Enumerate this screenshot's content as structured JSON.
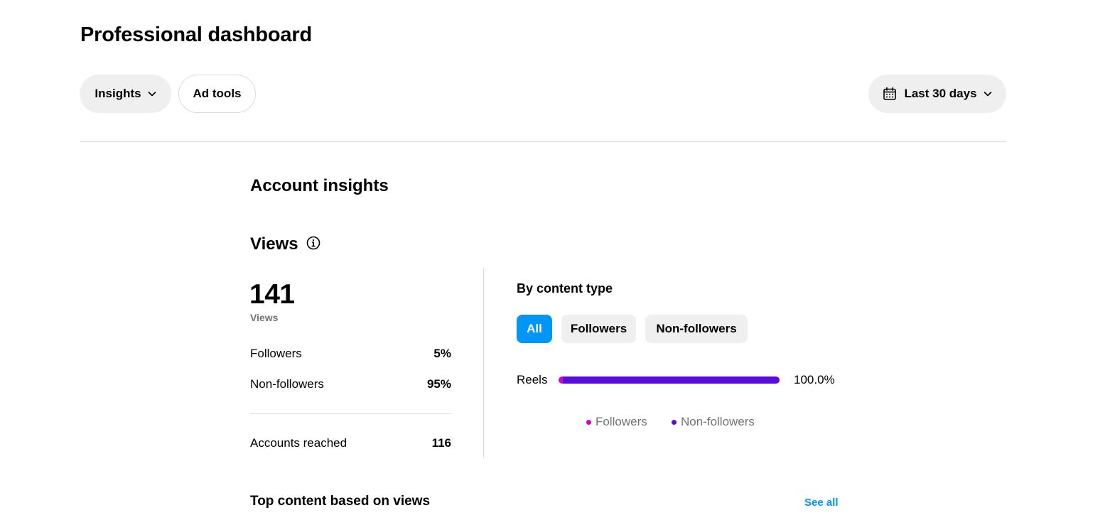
{
  "header": {
    "title": "Professional dashboard"
  },
  "toolbar": {
    "insights_label": "Insights",
    "ad_tools_label": "Ad tools",
    "date_range_label": "Last 30 days"
  },
  "account_insights": {
    "title": "Account insights",
    "views": {
      "heading": "Views",
      "total": "141",
      "total_caption": "Views",
      "rows": [
        {
          "label": "Followers",
          "value": "5%"
        },
        {
          "label": "Non-followers",
          "value": "95%"
        },
        {
          "label": "Accounts reached",
          "value": "116"
        }
      ]
    },
    "by_content_type": {
      "title": "By content type",
      "filters": [
        "All",
        "Followers",
        "Non-followers"
      ],
      "active_filter": "All",
      "bars": [
        {
          "label": "Reels",
          "percent_text": "100.0%",
          "followers_fraction": 0.02,
          "non_followers_fraction": 0.98
        }
      ],
      "legend": [
        "Followers",
        "Non-followers"
      ]
    }
  },
  "top_content": {
    "title": "Top content based on views",
    "see_all_label": "See all"
  },
  "colors": {
    "accent_blue": "#0095f6",
    "followers": "#d300c5",
    "non_followers": "#5b0bdf",
    "pill_bg": "#efefef",
    "divider": "#dbdbdb"
  },
  "icons": {
    "insights_chevron": "chevron-down-icon",
    "date_range_calendar": "calendar-icon",
    "date_range_chevron": "chevron-down-icon",
    "views_info": "info-icon"
  }
}
